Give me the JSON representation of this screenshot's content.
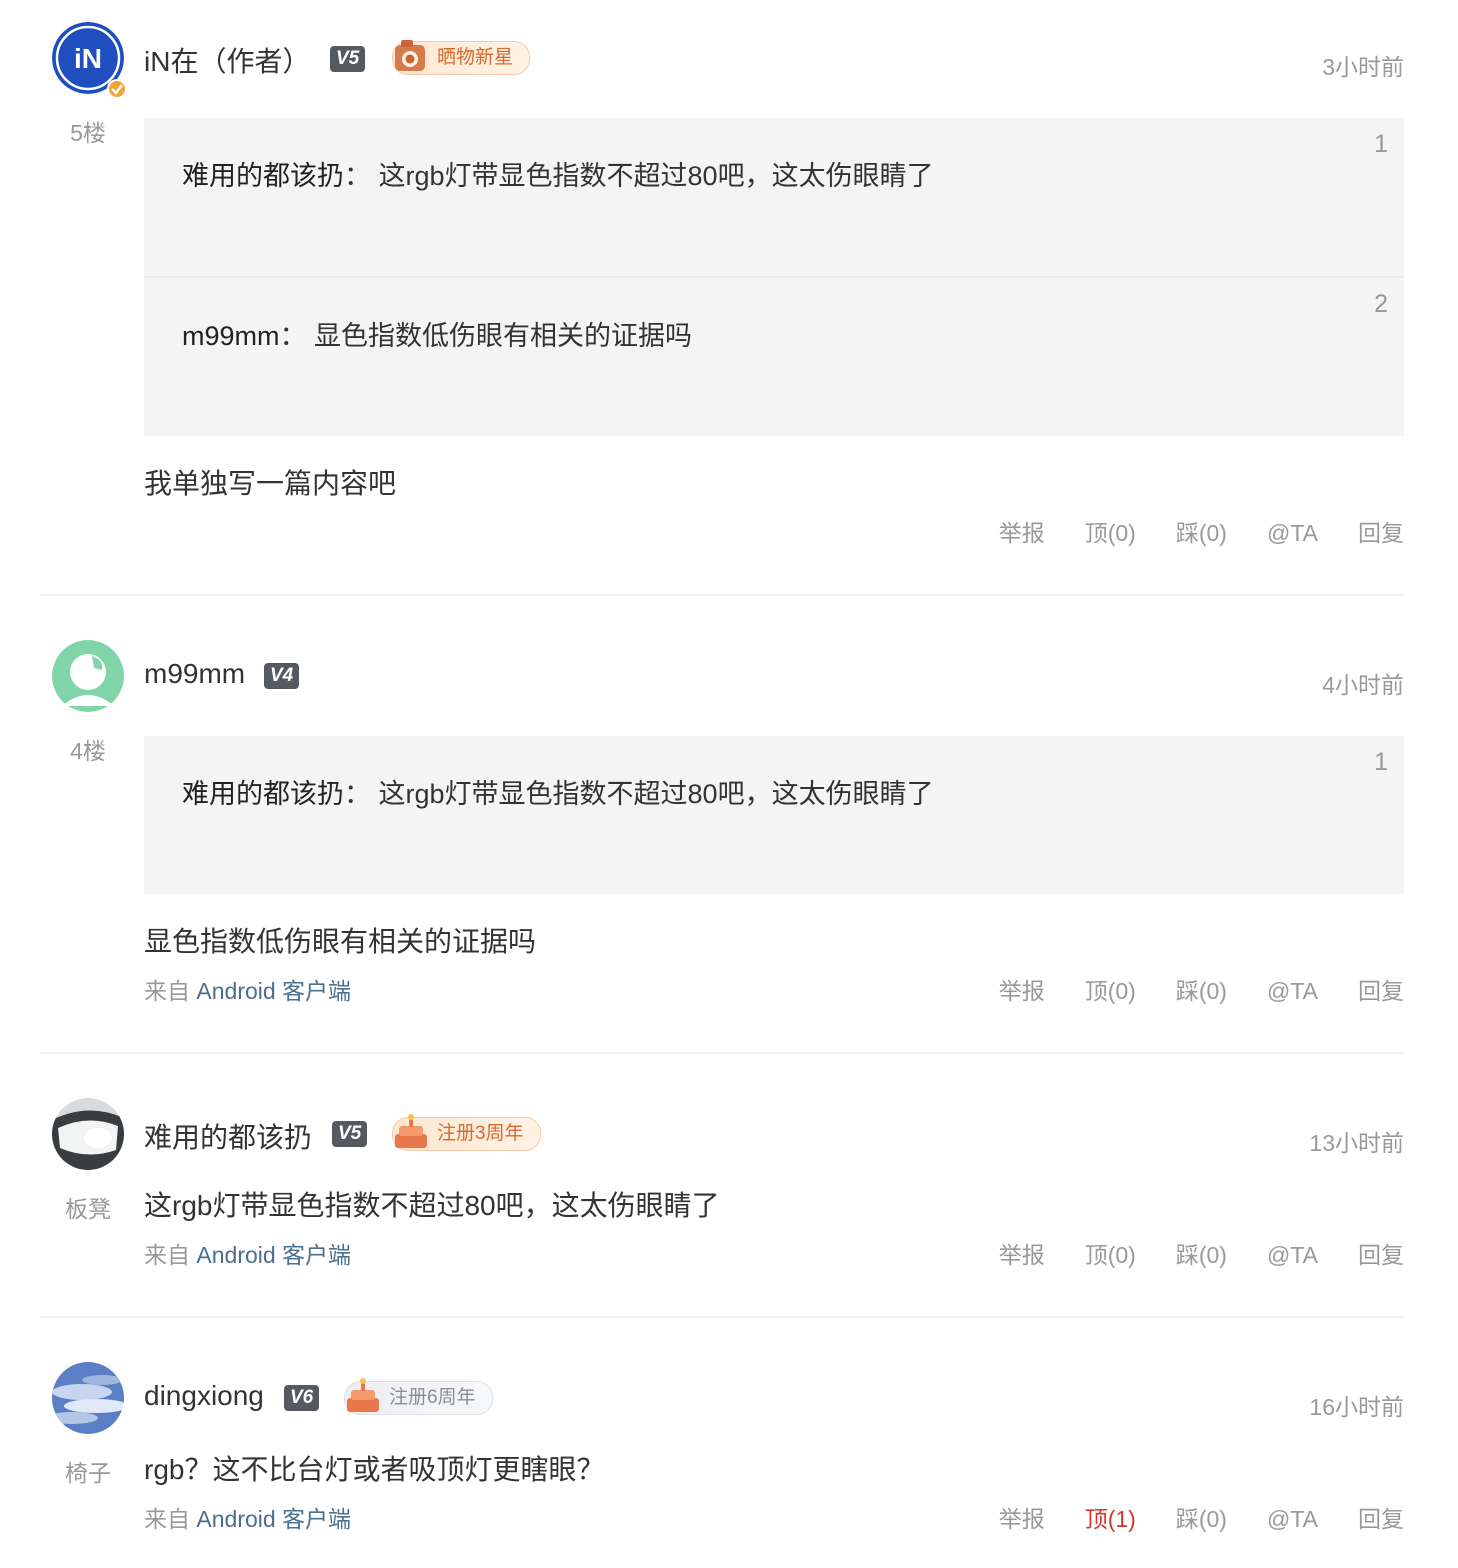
{
  "actions": {
    "report": "举报",
    "at": "@TA",
    "reply": "回复"
  },
  "colors": {
    "accent_red": "#d4372a",
    "link": "#4a6f8f",
    "quote_bg": "#f4f4f4"
  },
  "comments": [
    {
      "user": "iN在（作者）",
      "avatar_icon": "in-logo-avatar",
      "level": "V5",
      "medal": "晒物新星",
      "time": "3小时前",
      "floor": "5楼",
      "quotes": [
        {
          "num": "1",
          "user": "难用的都该扔",
          "sep": "：",
          "text": "这rgb灯带显色指数不超过80吧，这太伤眼睛了"
        },
        {
          "num": "2",
          "user": "m99mm",
          "sep": "：",
          "text": "显色指数低伤眼有相关的证据吗"
        }
      ],
      "content": "我单独写一篇内容吧",
      "up": "顶(0)",
      "down": "踩(0)"
    },
    {
      "user": "m99mm",
      "avatar_icon": "default-avatar",
      "level": "V4",
      "time": "4小时前",
      "floor": "4楼",
      "quotes": [
        {
          "num": "1",
          "user": "难用的都该扔",
          "sep": "：",
          "text": "这rgb灯带显色指数不超过80吧，这太伤眼睛了"
        }
      ],
      "content": "显色指数低伤眼有相关的证据吗",
      "source_prefix": "来自",
      "source_client": "Android 客户端",
      "up": "顶(0)",
      "down": "踩(0)"
    },
    {
      "user": "难用的都该扔",
      "avatar_icon": "photo-avatar",
      "level": "V5",
      "medal": "注册3周年",
      "time": "13小时前",
      "floor": "板凳",
      "content": "这rgb灯带显色指数不超过80吧，这太伤眼睛了",
      "source_prefix": "来自",
      "source_client": "Android 客户端",
      "up": "顶(0)",
      "down": "踩(0)"
    },
    {
      "user": "dingxiong",
      "avatar_icon": "sky-avatar",
      "level": "V6",
      "medal": "注册6周年",
      "time": "16小时前",
      "floor": "椅子",
      "content": "rgb？这不比台灯或者吸顶灯更瞎眼？",
      "source_prefix": "来自",
      "source_client": "Android 客户端",
      "up": "顶(1)",
      "down": "踩(0)"
    }
  ]
}
